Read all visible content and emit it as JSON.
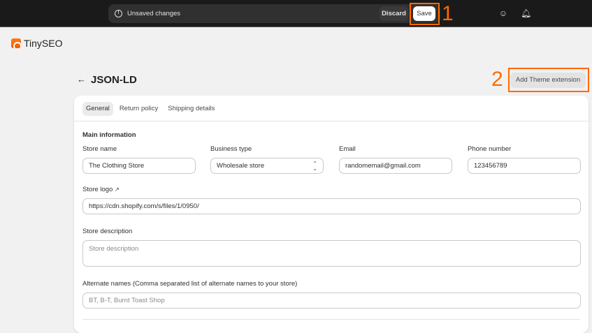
{
  "topbar": {
    "unsaved_label": "Unsaved changes",
    "discard_label": "Discard",
    "save_label": "Save"
  },
  "annotations": {
    "one": "1",
    "two": "2",
    "color": "#ff6a00"
  },
  "brand": {
    "name": "TinySEO"
  },
  "page": {
    "title": "JSON-LD",
    "add_theme_label": "Add Theme extension"
  },
  "tabs": [
    {
      "label": "General"
    },
    {
      "label": "Return policy"
    },
    {
      "label": "Shipping details"
    }
  ],
  "form": {
    "section": "Main information",
    "store_name": {
      "label": "Store name",
      "value": "The Clothing Store"
    },
    "business_type": {
      "label": "Business type",
      "value": "Wholesale store"
    },
    "email": {
      "label": "Email",
      "value": "randomemail@gmail.com"
    },
    "phone": {
      "label": "Phone number",
      "value": "123456789"
    },
    "store_logo": {
      "label": "Store logo",
      "value": "https://cdn.shopify.com/s/files/1/0950/"
    },
    "store_description": {
      "label": "Store description",
      "placeholder": "Store description"
    },
    "alternate_names": {
      "label": "Alternate names (Comma separated list of alternate names to your store)",
      "placeholder": "BT, B-T, Burnt Toast Shop"
    }
  }
}
